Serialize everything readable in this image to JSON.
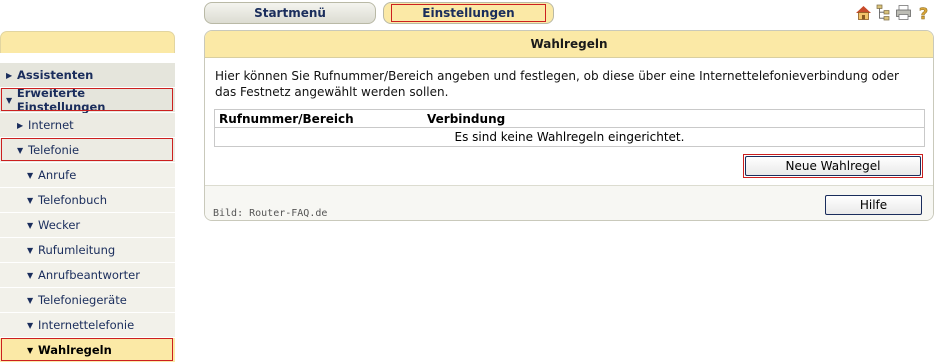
{
  "top_tabs": {
    "start": "Startmenü",
    "settings": "Einstellungen"
  },
  "top_icons": [
    "home-icon",
    "tree-icon",
    "print-icon",
    "help-icon"
  ],
  "sidebar": {
    "items": [
      {
        "label": "Assistenten",
        "arrow": "▶"
      },
      {
        "label": "Erweiterte Einstellungen",
        "arrow": "▼"
      },
      {
        "label": "Internet",
        "arrow": "▶"
      },
      {
        "label": "Telefonie",
        "arrow": "▼"
      },
      {
        "label": "Anrufe",
        "arrow": "▼"
      },
      {
        "label": "Telefonbuch",
        "arrow": "▼"
      },
      {
        "label": "Wecker",
        "arrow": "▼"
      },
      {
        "label": "Rufumleitung",
        "arrow": "▼"
      },
      {
        "label": "Anrufbeantworter",
        "arrow": "▼"
      },
      {
        "label": "Telefoniegeräte",
        "arrow": "▼"
      },
      {
        "label": "Internettelefonie",
        "arrow": "▼"
      },
      {
        "label": "Wahlregeln",
        "arrow": "▼"
      }
    ]
  },
  "panel": {
    "title": "Wahlregeln",
    "description": "Hier können Sie Rufnummer/Bereich angeben und festlegen, ob diese über eine Internettelefonieverbindung oder das Festnetz angewählt werden sollen.",
    "table": {
      "headers": [
        "Rufnummer/Bereich",
        "Verbindung"
      ],
      "empty_text": "Es sind keine Wahlregeln eingerichtet."
    },
    "new_rule_button": "Neue Wahlregel",
    "credit": "Bild: Router-FAQ.de",
    "help_button": "Hilfe"
  },
  "colors": {
    "accent": "#fbe9a6",
    "nav_text": "#1a2d5c",
    "highlight": "#cc1f1f"
  }
}
